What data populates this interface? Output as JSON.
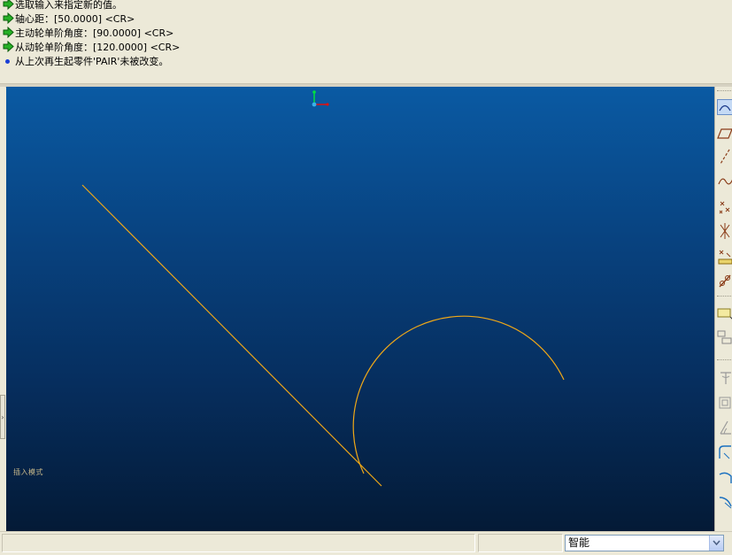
{
  "messages": [
    {
      "type": "prompt",
      "text": "选取输入来指定新的值。"
    },
    {
      "type": "prompt",
      "text": "轴心距：[50.0000]   <CR>"
    },
    {
      "type": "prompt",
      "text": "主动轮单阶角度：[90.0000]   <CR>"
    },
    {
      "type": "prompt",
      "text": "从动轮单阶角度：[120.0000]   <CR>"
    },
    {
      "type": "info",
      "text": "从上次再生起零件'PAIR'未被改变。"
    }
  ],
  "viewport": {
    "background_top": "#0a5aa3",
    "background_bottom": "#041a36",
    "curve_color": "#f0a817",
    "mode_label": "插入模式"
  },
  "colors": {
    "prompt_arrow": "#1e9e1e",
    "info_dot": "#1a3fd6",
    "panel": "#ece9d8"
  },
  "right_toolbar": {
    "icons": [
      "sketch-arc-icon",
      "parallelogram-icon",
      "centerline-icon",
      "spline-icon",
      "point-icon",
      "coordinate-system-icon",
      "dimension-icon",
      "modify-icon",
      "text-icon",
      "palette-icon",
      "trim-icon",
      "mirror-icon",
      "constraint-icon",
      "fillet-icon",
      "arc-tangent-icon",
      "curve-icon"
    ]
  },
  "status_bar": {
    "filter_value": "智能"
  }
}
